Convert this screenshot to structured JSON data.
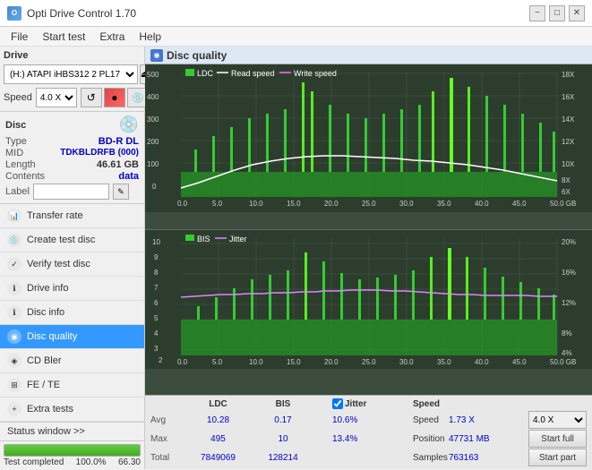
{
  "titleBar": {
    "title": "Opti Drive Control 1.70",
    "minimize": "−",
    "maximize": "□",
    "close": "✕"
  },
  "menuBar": {
    "items": [
      "File",
      "Start test",
      "Extra",
      "Help"
    ]
  },
  "toolbar": {
    "driveLabel": "Drive",
    "driveValue": "(H:) ATAPI iHBS312  2 PL17",
    "speedLabel": "Speed",
    "speedValue": "4.0 X"
  },
  "disc": {
    "title": "Disc",
    "typeLabel": "Type",
    "typeValue": "BD-R DL",
    "midLabel": "MID",
    "midValue": "TDKBLDRFB (000)",
    "lengthLabel": "Length",
    "lengthValue": "46.61 GB",
    "contentsLabel": "Contents",
    "contentsValue": "data",
    "labelLabel": "Label",
    "labelValue": ""
  },
  "navItems": [
    {
      "id": "transfer-rate",
      "label": "Transfer rate"
    },
    {
      "id": "create-test-disc",
      "label": "Create test disc"
    },
    {
      "id": "verify-test-disc",
      "label": "Verify test disc"
    },
    {
      "id": "drive-info",
      "label": "Drive info"
    },
    {
      "id": "disc-info",
      "label": "Disc info"
    },
    {
      "id": "disc-quality",
      "label": "Disc quality",
      "active": true
    },
    {
      "id": "cd-bler",
      "label": "CD Bler"
    },
    {
      "id": "fe-te",
      "label": "FE / TE"
    },
    {
      "id": "extra-tests",
      "label": "Extra tests"
    }
  ],
  "statusWindow": {
    "label": "Status window >>",
    "statusText": "Test completed",
    "progressValue": "100.0%",
    "rightValue": "66.30"
  },
  "discQuality": {
    "title": "Disc quality",
    "legend": {
      "ldc": "LDC",
      "readSpeed": "Read speed",
      "writeSpeed": "Write speed",
      "bis": "BIS",
      "jitter": "Jitter"
    }
  },
  "statsPanel": {
    "headers": [
      "LDC",
      "BIS",
      "",
      "Jitter",
      "Speed",
      ""
    ],
    "avgLabel": "Avg",
    "maxLabel": "Max",
    "totalLabel": "Total",
    "ldcAvg": "10.28",
    "ldcMax": "495",
    "ldcTotal": "7849069",
    "bisAvg": "0.17",
    "bisMax": "10",
    "bisTotal": "128214",
    "jitterAvg": "10.6%",
    "jitterMax": "13.4%",
    "jitterTotal": "",
    "speedLabel": "Speed",
    "speedValue": "1.73 X",
    "speedSelect": "4.0 X",
    "positionLabel": "Position",
    "positionValue": "47731 MB",
    "samplesLabel": "Samples",
    "samplesValue": "763163",
    "startFull": "Start full",
    "startPart": "Start part",
    "jitterChecked": true
  }
}
